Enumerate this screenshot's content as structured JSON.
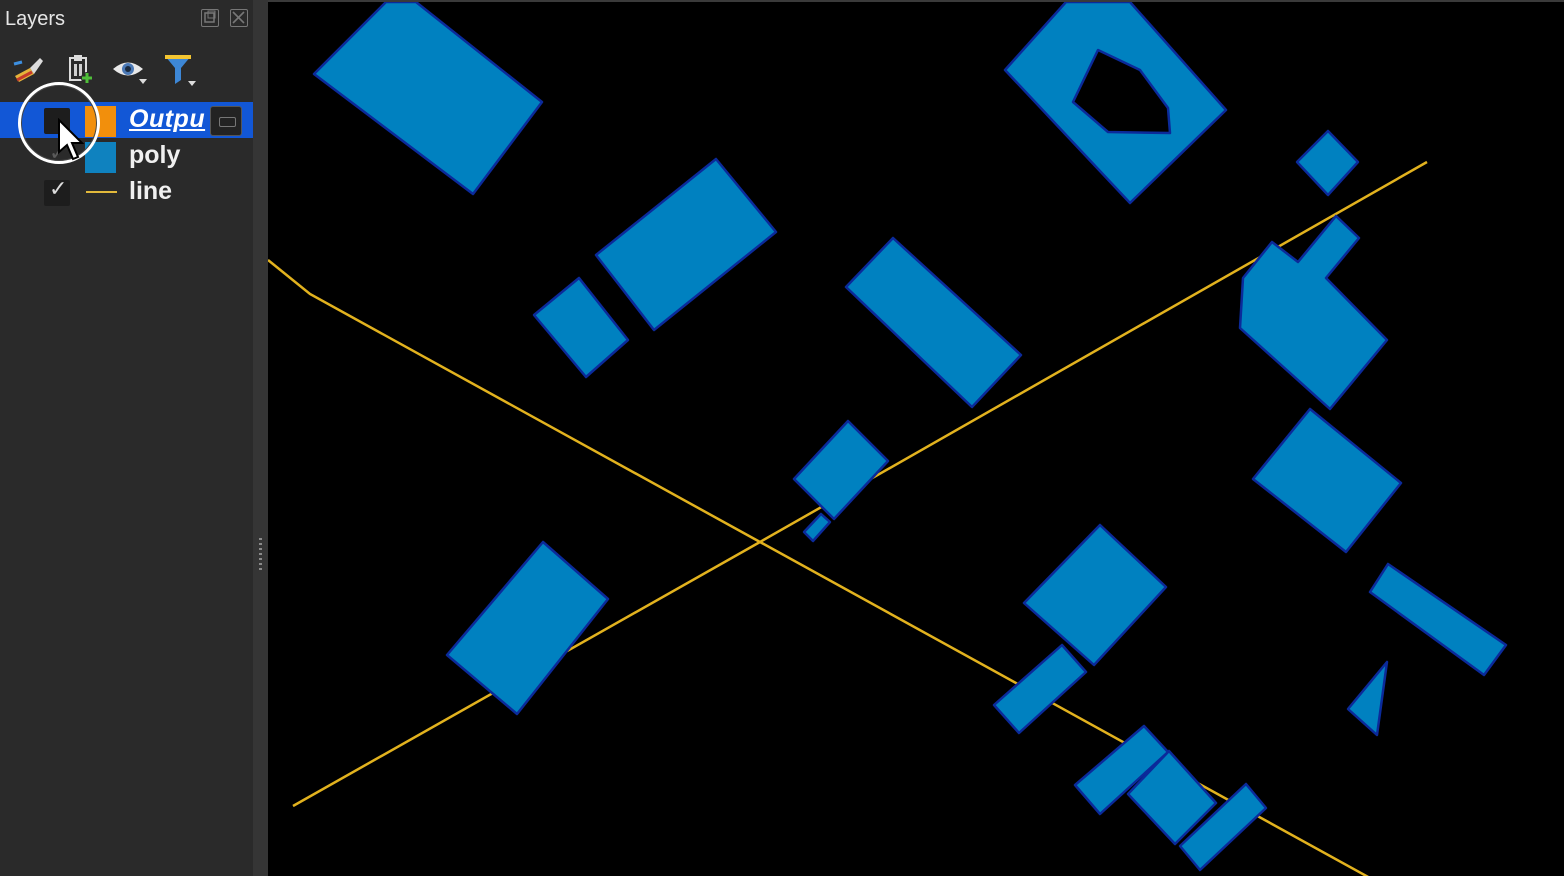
{
  "panel": {
    "title": "Layers",
    "layers": [
      {
        "name": "Outpu",
        "type": "polygon",
        "checked": false,
        "selected": true,
        "swatch_color": "#f28f0c"
      },
      {
        "name": "poly",
        "type": "polygon",
        "checked": true,
        "selected": false,
        "swatch_color": "#0f82bf"
      },
      {
        "name": "line",
        "type": "line",
        "checked": true,
        "selected": false,
        "swatch_color": "#e2b93b"
      }
    ],
    "checkmark": "✓",
    "toolbar_icons": [
      "style-brush-icon",
      "add-group-icon",
      "visibility-eye-icon",
      "filter-funnel-icon"
    ],
    "title_icons": [
      "float-panel-icon",
      "close-panel-icon"
    ]
  },
  "map": {
    "background": "#000000",
    "polygon_fill": "#0081c0",
    "polygon_stroke": "#0b2a9a",
    "line_color": "#e2b21e"
  },
  "colors": {
    "selection": "#1257d6",
    "panel_bg": "#2a2a2a"
  }
}
